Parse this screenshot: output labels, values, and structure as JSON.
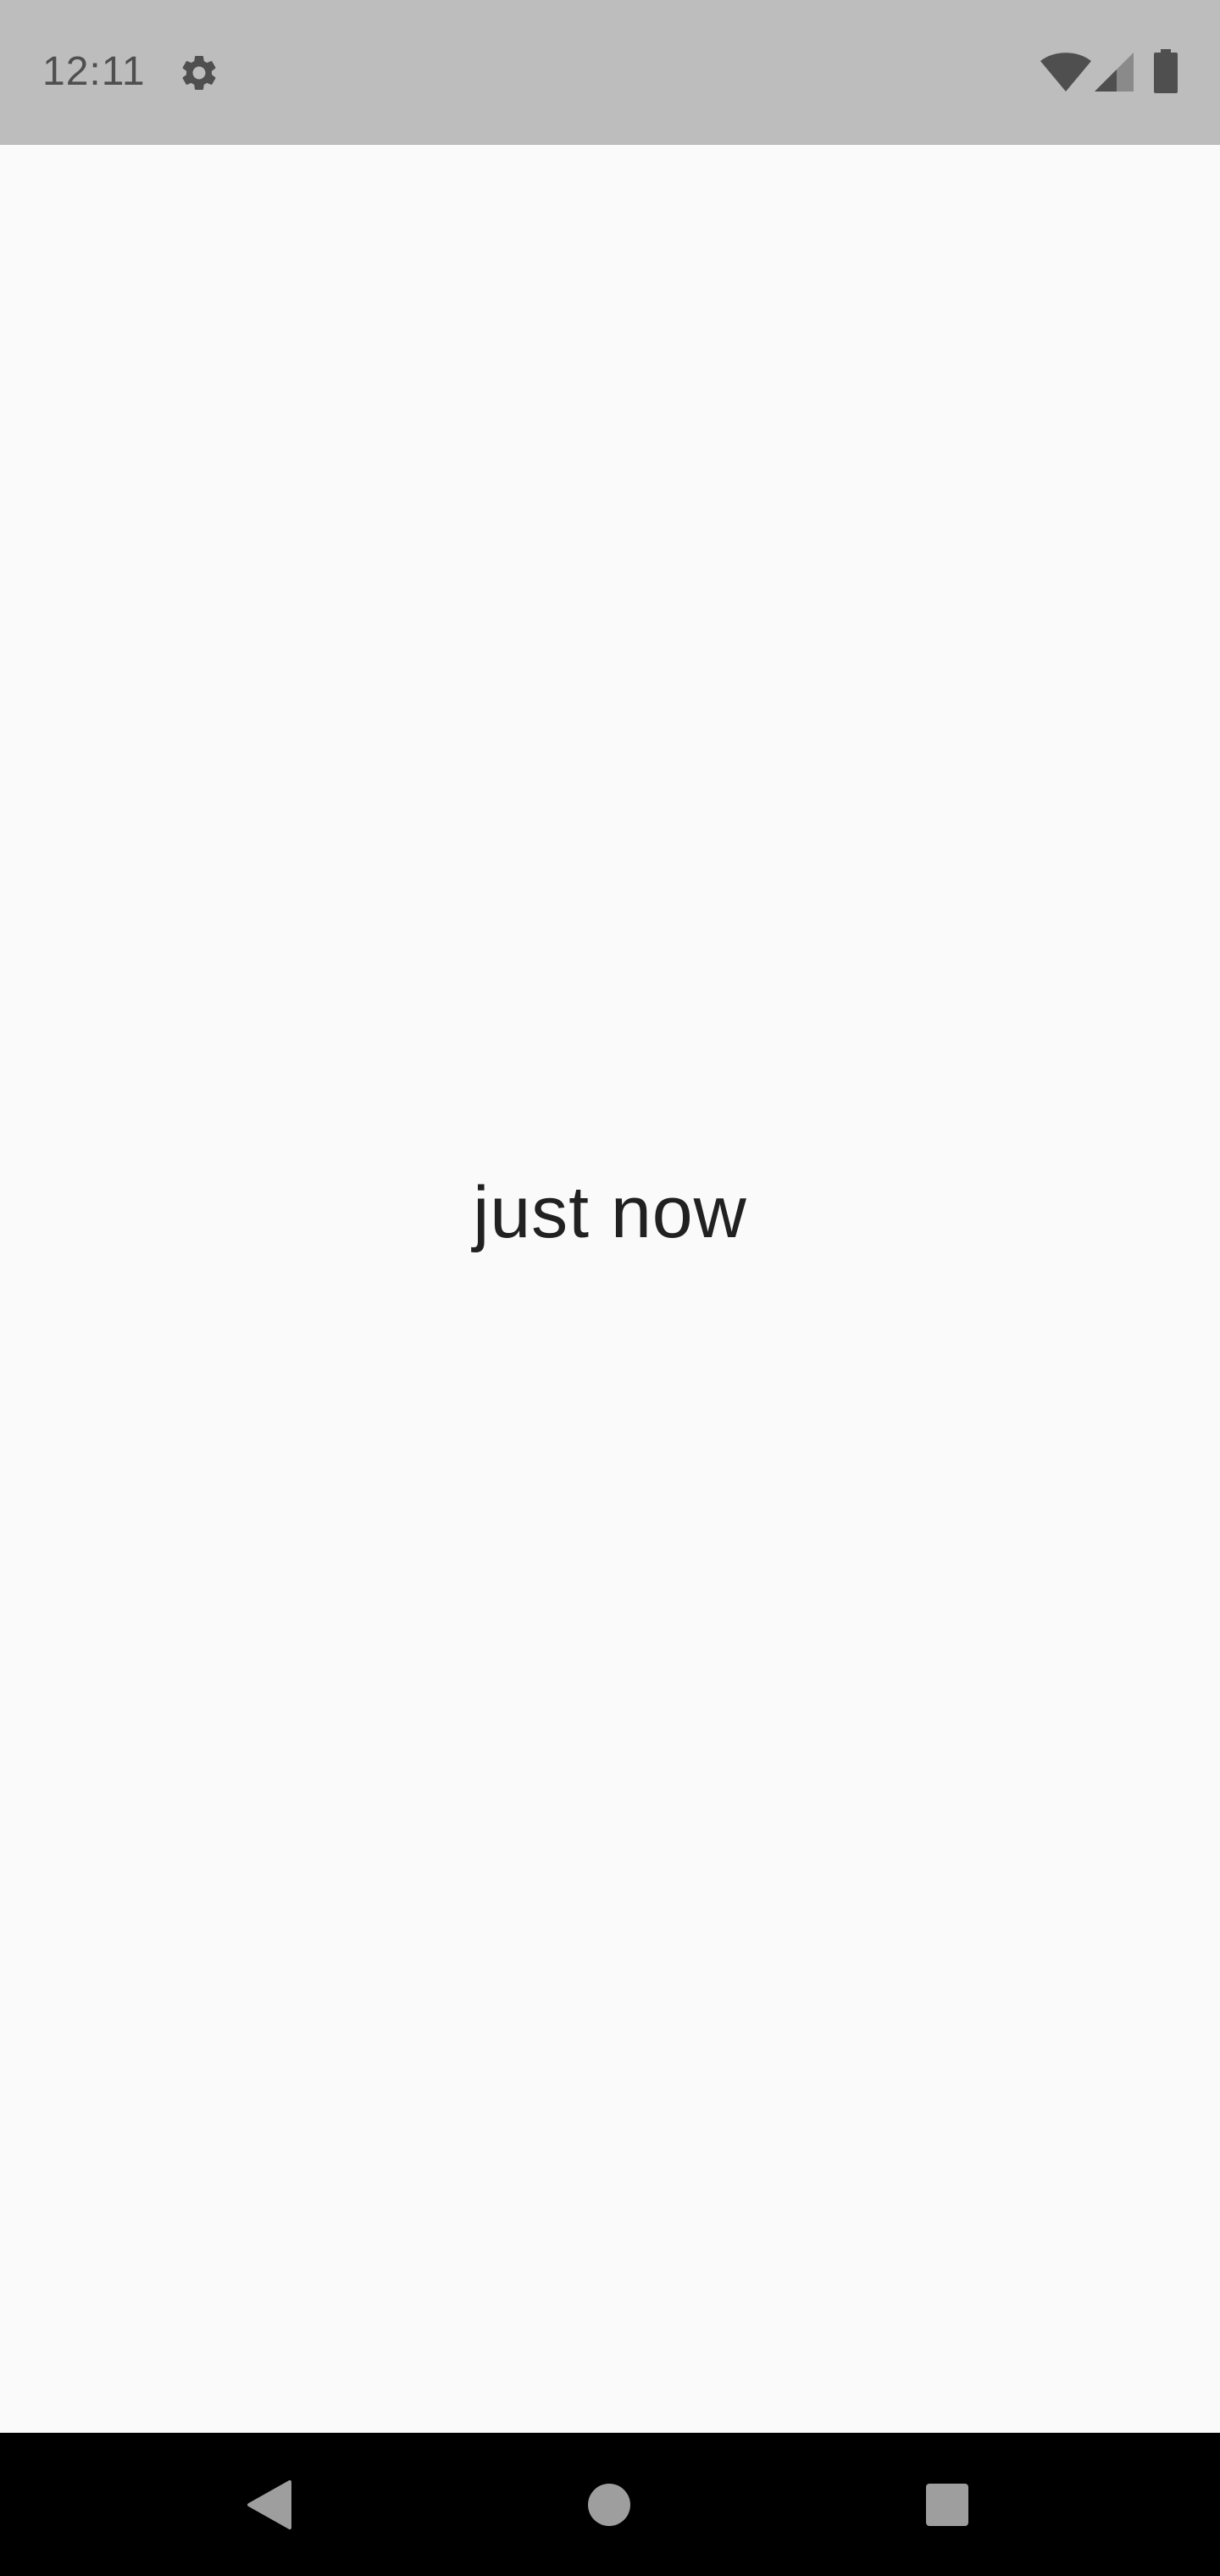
{
  "status_bar": {
    "time": "12:11",
    "icons": [
      "gear-icon",
      "wifi-icon",
      "signal-icon",
      "battery-icon"
    ]
  },
  "main": {
    "relative_time_text": "just now"
  },
  "navigation_bar": {
    "buttons": [
      "back-icon",
      "home-icon",
      "recents-icon"
    ]
  },
  "colors": {
    "status_bar_bg": "#bdbdbd",
    "status_icon": "#4f4f4f",
    "content_bg": "#fafafa",
    "text": "#212121",
    "nav_bar_bg": "#000000",
    "nav_icon": "#9e9e9e"
  }
}
